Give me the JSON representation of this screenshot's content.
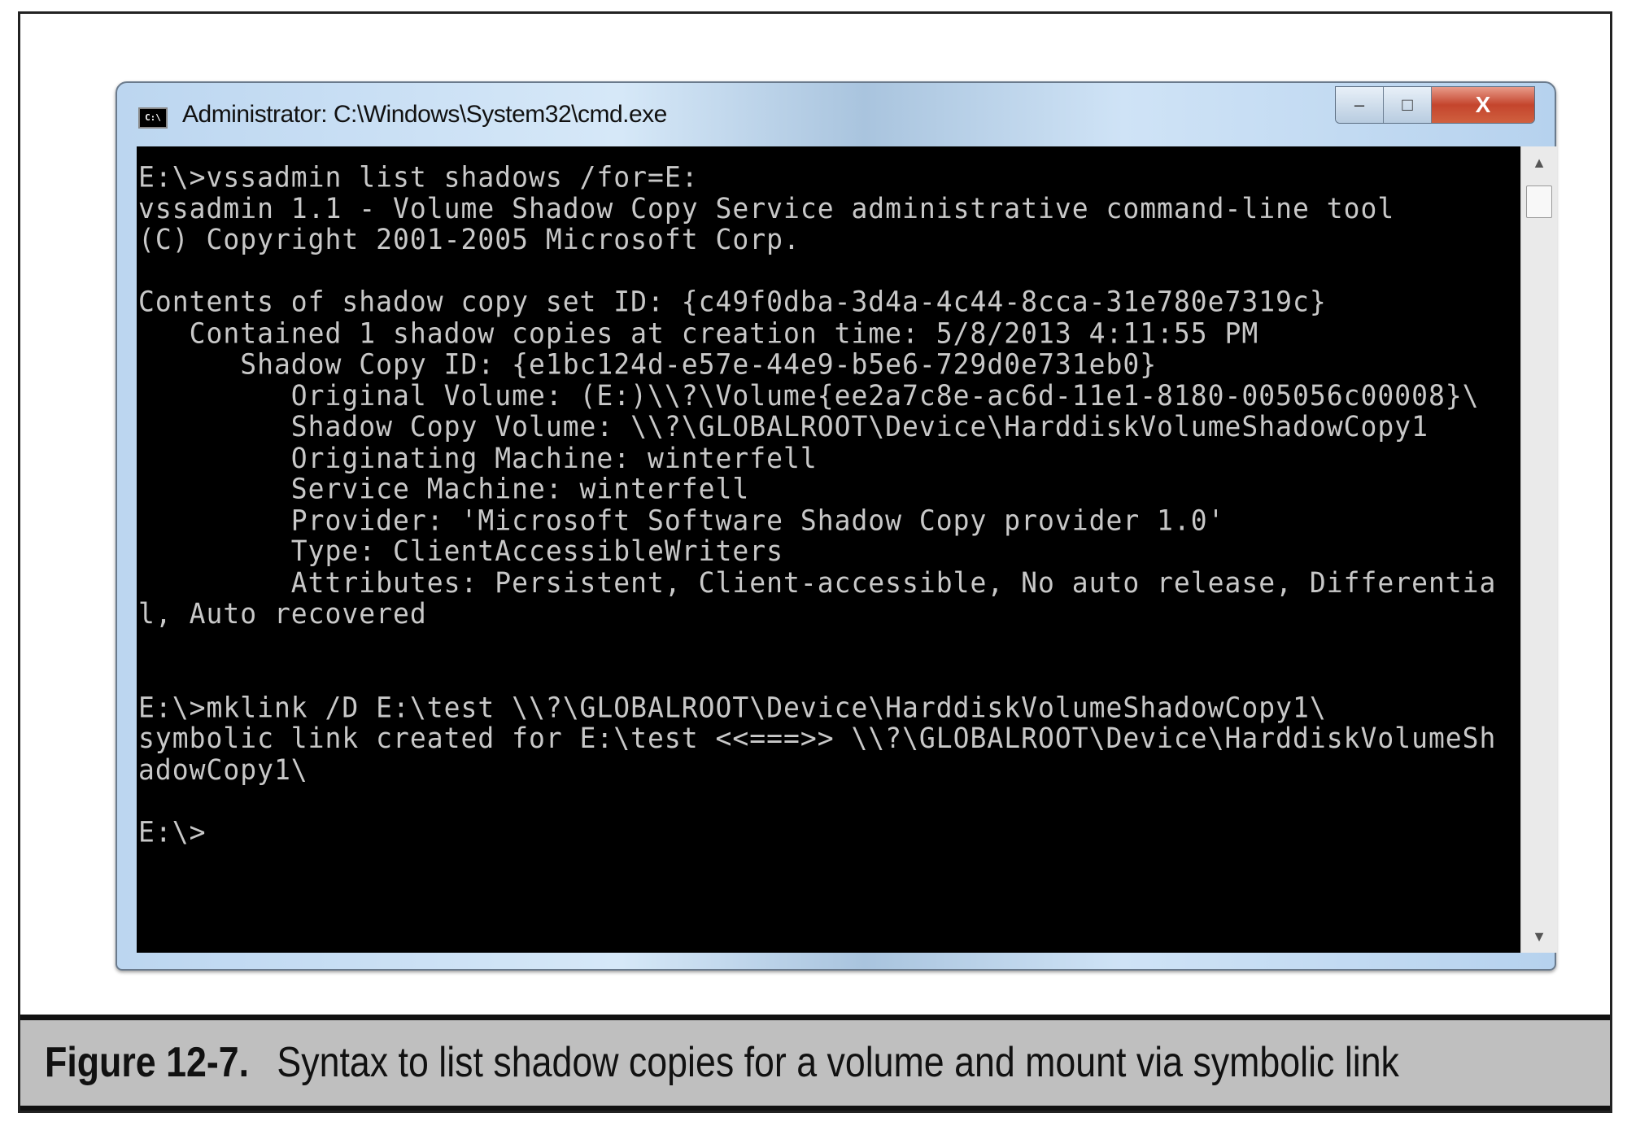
{
  "window": {
    "title": "Administrator: C:\\Windows\\System32\\cmd.exe",
    "icon_label": "C:\\",
    "buttons": {
      "minimize": "–",
      "maximize": "□",
      "close": "X"
    }
  },
  "console": {
    "lines": [
      "E:\\>vssadmin list shadows /for=E:",
      "vssadmin 1.1 - Volume Shadow Copy Service administrative command-line tool",
      "(C) Copyright 2001-2005 Microsoft Corp.",
      "",
      "Contents of shadow copy set ID: {c49f0dba-3d4a-4c44-8cca-31e780e7319c}",
      "   Contained 1 shadow copies at creation time: 5/8/2013 4:11:55 PM",
      "      Shadow Copy ID: {e1bc124d-e57e-44e9-b5e6-729d0e731eb0}",
      "         Original Volume: (E:)\\\\?\\Volume{ee2a7c8e-ac6d-11e1-8180-005056c00008}\\",
      "         Shadow Copy Volume: \\\\?\\GLOBALROOT\\Device\\HarddiskVolumeShadowCopy1",
      "         Originating Machine: winterfell",
      "         Service Machine: winterfell",
      "         Provider: 'Microsoft Software Shadow Copy provider 1.0'",
      "         Type: ClientAccessibleWriters",
      "         Attributes: Persistent, Client-accessible, No auto release, Differentia",
      "l, Auto recovered",
      "",
      "",
      "E:\\>mklink /D E:\\test \\\\?\\GLOBALROOT\\Device\\HarddiskVolumeShadowCopy1\\",
      "symbolic link created for E:\\test <<===>> \\\\?\\GLOBALROOT\\Device\\HarddiskVolumeSh",
      "adowCopy1\\",
      "",
      "E:\\>"
    ]
  },
  "scrollbar": {
    "up": "▲",
    "down": "▼"
  },
  "caption": {
    "number": "Figure 12-7.",
    "text": "Syntax to list shadow copies for a volume and mount via symbolic link"
  }
}
